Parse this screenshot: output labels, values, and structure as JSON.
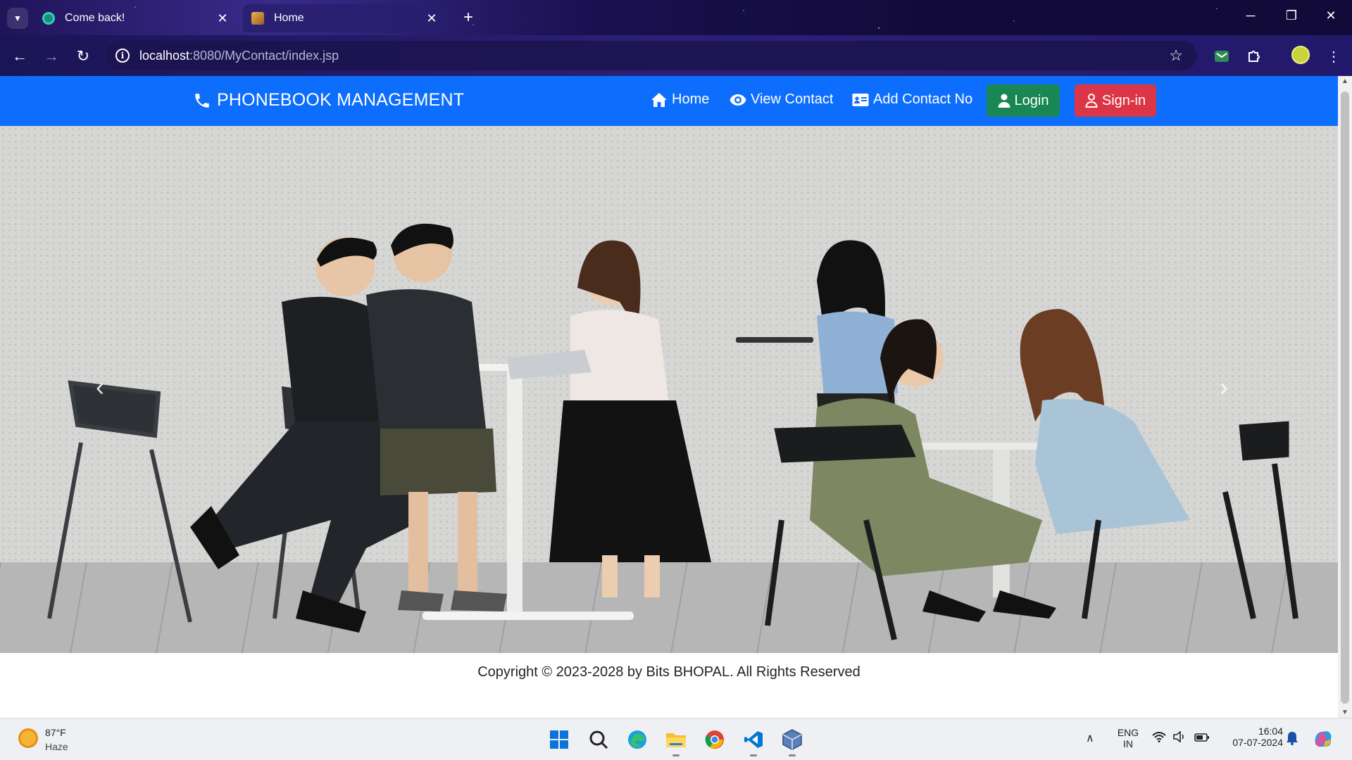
{
  "browser": {
    "tabs": [
      {
        "title": "Come back!",
        "active": false
      },
      {
        "title": "Home",
        "active": true
      }
    ],
    "url_host": "localhost",
    "url_path": ":8080/MyContact/index.jsp",
    "icons": [
      "tab-list-icon",
      "new-tab-icon",
      "minimize-icon",
      "restore-icon",
      "close-window-icon",
      "back-icon",
      "forward-icon",
      "reload-icon",
      "site-info-icon",
      "bookmark-star-icon",
      "extension-mail-icon",
      "extensions-puzzle-icon",
      "profile-avatar",
      "menu-dots-icon"
    ]
  },
  "page": {
    "brand": "PHONEBOOK MANAGEMENT",
    "nav": {
      "home": "Home",
      "view_contact": "View Contact",
      "add_contact": "Add Contact No",
      "login": "Login",
      "signin": "Sign-in"
    },
    "carousel": {
      "prev_icon": "‹",
      "next_icon": "›"
    },
    "footer": "Copyright © 2023-2028 by Bits BHOPAL. All Rights Reserved",
    "colors": {
      "navbar": "#0d6efd",
      "login_button": "#198754",
      "signin_button": "#dc3545"
    }
  },
  "taskbar": {
    "weather_temp": "87°F",
    "weather_desc": "Haze",
    "language": "ENG",
    "region": "IN",
    "time": "16:04",
    "date": "07-07-2024",
    "apps": [
      "windows-start-icon",
      "search-icon",
      "edge-icon",
      "file-explorer-icon",
      "chrome-icon",
      "vscode-icon",
      "virtualbox-icon"
    ]
  }
}
